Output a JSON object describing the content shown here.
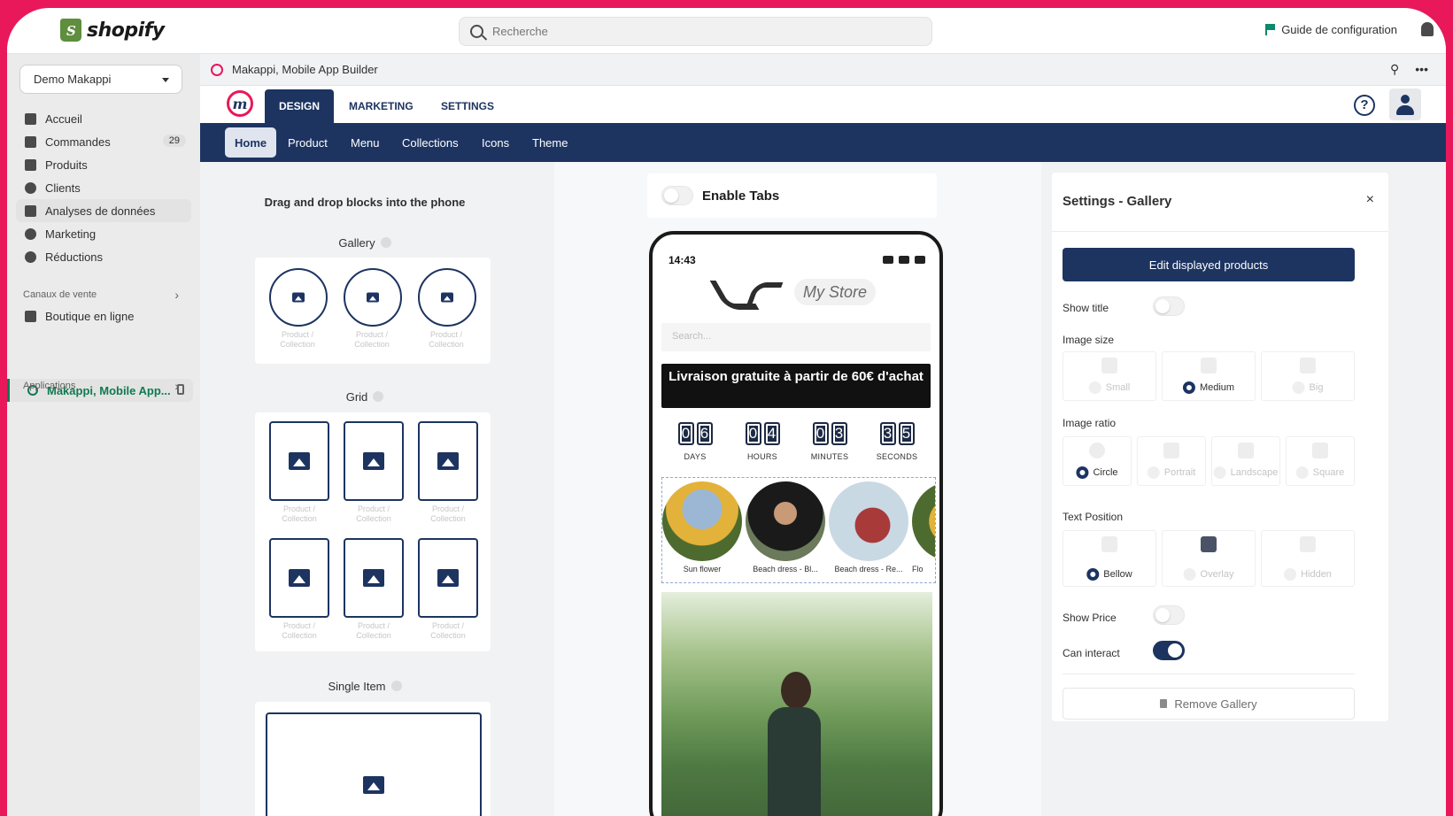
{
  "topbar": {
    "logo_text": "shopify",
    "search_placeholder": "Recherche",
    "guide_label": "Guide de configuration"
  },
  "sidebar": {
    "store": "Demo Makappi",
    "items": [
      {
        "label": "Accueil",
        "icon": "home-icon"
      },
      {
        "label": "Commandes",
        "icon": "orders-icon",
        "badge": "29"
      },
      {
        "label": "Produits",
        "icon": "tag-icon"
      },
      {
        "label": "Clients",
        "icon": "person-icon"
      },
      {
        "label": "Analyses de données",
        "icon": "chart-icon"
      },
      {
        "label": "Marketing",
        "icon": "target-icon"
      },
      {
        "label": "Réductions",
        "icon": "discount-icon"
      }
    ],
    "sales_channels_label": "Canaux de vente",
    "online_store": "Boutique en ligne",
    "app_active": "Makappi, Mobile App...",
    "applications_label": "Applications"
  },
  "app_header": {
    "title": "Makappi, Mobile App Builder"
  },
  "app_nav": {
    "logo_letter": "m",
    "tabs": [
      "DESIGN",
      "MARKETING",
      "SETTINGS"
    ],
    "help_symbol": "?"
  },
  "sub_nav": {
    "tabs": [
      "Home",
      "Product",
      "Menu",
      "Collections",
      "Icons",
      "Theme"
    ]
  },
  "left_panel": {
    "title": "Drag and drop blocks into the phone",
    "gallery_label": "Gallery",
    "grid_label": "Grid",
    "single_label": "Single Item",
    "slot_caption_1": "Product /",
    "slot_caption_2": "Collection"
  },
  "center": {
    "enable_tabs": "Enable Tabs",
    "phone": {
      "time": "14:43",
      "store_name": "My Store",
      "search_placeholder": "Search...",
      "promo": "Livraison gratuite à partir de 60€ d'achat",
      "countdown": [
        {
          "digits": [
            "0",
            "6"
          ],
          "label": "DAYS"
        },
        {
          "digits": [
            "0",
            "4"
          ],
          "label": "HOURS"
        },
        {
          "digits": [
            "0",
            "3"
          ],
          "label": "MINUTES"
        },
        {
          "digits": [
            "3",
            "5"
          ],
          "label": "SECONDS"
        }
      ],
      "gallery_items": [
        "Sun flower",
        "Beach dress - Bl...",
        "Beach dress - Re...",
        "Flo"
      ]
    }
  },
  "settings": {
    "title": "Settings - Gallery",
    "close": "×",
    "edit_button": "Edit displayed products",
    "show_title": "Show title",
    "image_size": "Image size",
    "size_options": [
      "Small",
      "Medium",
      "Big"
    ],
    "size_selected": "Medium",
    "image_ratio": "Image ratio",
    "ratio_options": [
      "Circle",
      "Portrait",
      "Landscape",
      "Square"
    ],
    "ratio_selected": "Circle",
    "text_position": "Text Position",
    "position_options": [
      "Bellow",
      "Overlay",
      "Hidden"
    ],
    "position_selected": "Bellow",
    "show_price": "Show Price",
    "can_interact": "Can interact",
    "remove_button": "Remove Gallery"
  },
  "colors": {
    "brand_frame": "#e8185a",
    "navy": "#1d3461",
    "shopify_green": "#5e8e3e"
  }
}
